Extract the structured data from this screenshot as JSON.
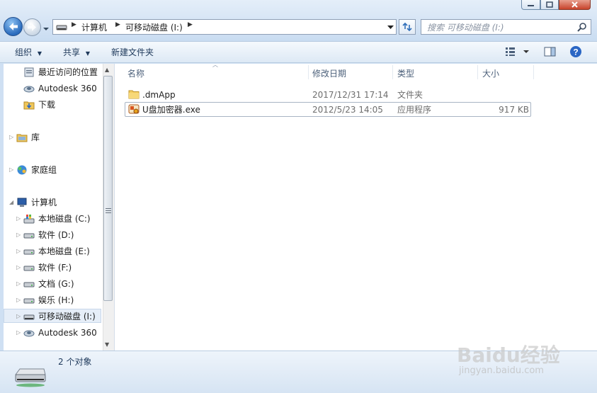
{
  "address": {
    "breadcrumb": [
      "计算机",
      "可移动磁盘 (I:)"
    ],
    "search_placeholder": "搜索 可移动磁盘 (I:)"
  },
  "toolbar": {
    "organize": "组织",
    "share": "共享",
    "new_folder": "新建文件夹"
  },
  "nav": {
    "items": [
      {
        "label": "最近访问的位置",
        "icon": "recent-places-icon"
      },
      {
        "label": "Autodesk 360",
        "icon": "cloud-drive-icon"
      },
      {
        "label": "下载",
        "icon": "downloads-folder-icon"
      },
      {
        "label": "库",
        "icon": "library-icon"
      },
      {
        "label": "家庭组",
        "icon": "homegroup-icon"
      },
      {
        "label": "计算机",
        "icon": "computer-icon"
      },
      {
        "label": "本地磁盘 (C:)",
        "icon": "system-drive-icon"
      },
      {
        "label": "软件 (D:)",
        "icon": "drive-icon"
      },
      {
        "label": "本地磁盘 (E:)",
        "icon": "drive-icon"
      },
      {
        "label": "软件 (F:)",
        "icon": "drive-icon"
      },
      {
        "label": "文档 (G:)",
        "icon": "drive-icon"
      },
      {
        "label": "娱乐 (H:)",
        "icon": "drive-icon"
      },
      {
        "label": "可移动磁盘 (I:)",
        "icon": "removable-drive-icon"
      },
      {
        "label": "Autodesk 360",
        "icon": "cloud-drive-icon"
      }
    ]
  },
  "columns": {
    "name": "名称",
    "date": "修改日期",
    "type": "类型",
    "size": "大小"
  },
  "files": [
    {
      "name": ".dmApp",
      "date": "2017/12/31 17:14",
      "type": "文件夹",
      "size": "",
      "icon": "folder-icon"
    },
    {
      "name": "U盘加密器.exe",
      "date": "2012/5/23 14:05",
      "type": "应用程序",
      "size": "917 KB",
      "icon": "application-icon"
    }
  ],
  "status": {
    "count": "2 个对象"
  },
  "watermark": {
    "brand": "Baidu经验",
    "url": "jingyan.baidu.com"
  }
}
